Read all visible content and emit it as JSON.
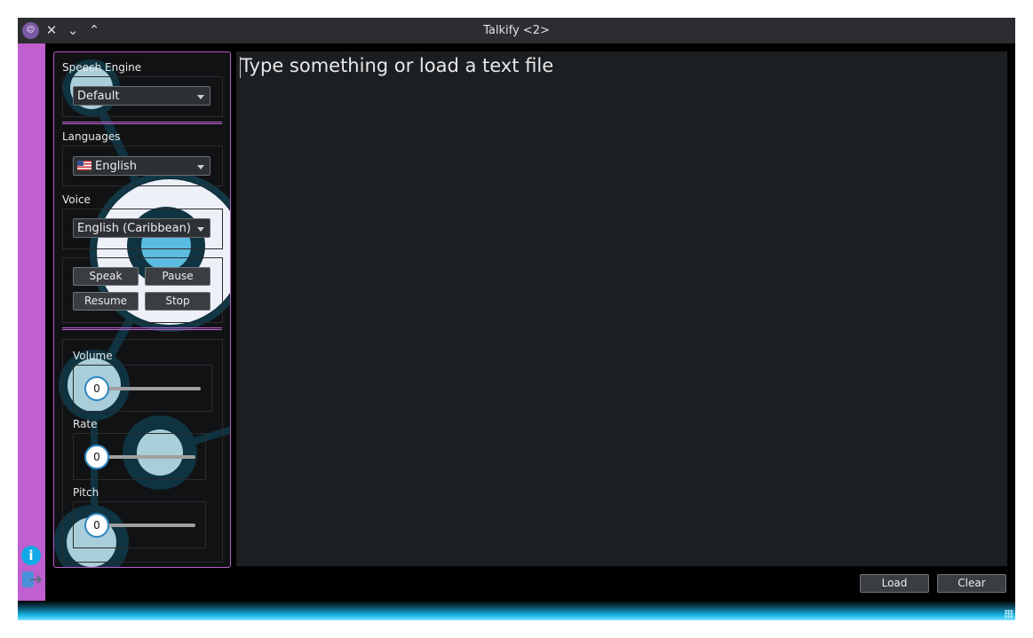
{
  "window": {
    "title": "Talkify <2>",
    "controls": {
      "close": "✕",
      "minimize": "⌄",
      "maximize": "⌃"
    }
  },
  "sidebar_strip": {
    "icons": [
      "info-icon",
      "exit-icon"
    ],
    "color": "#c05fcf"
  },
  "engine": {
    "label": "Speech Engine",
    "selected": "Default"
  },
  "languages": {
    "label": "Languages",
    "selected": "English",
    "flag": "us-flag-icon"
  },
  "voice": {
    "label": "Voice",
    "selected": "English (Caribbean)"
  },
  "playback": {
    "speak": "Speak",
    "pause": "Pause",
    "resume": "Resume",
    "stop": "Stop"
  },
  "sliders": {
    "volume": {
      "label": "Volume",
      "value": "0"
    },
    "rate": {
      "label": "Rate",
      "value": "0"
    },
    "pitch": {
      "label": "Pitch",
      "value": "0"
    }
  },
  "editor": {
    "placeholder": "Type something or load a text file"
  },
  "footer": {
    "load": "Load",
    "clear": "Clear"
  },
  "colors": {
    "accent": "#c05fcf",
    "info": "#11a9e6",
    "editor_bg": "#1c1f22",
    "glow": "#16b8ea"
  }
}
